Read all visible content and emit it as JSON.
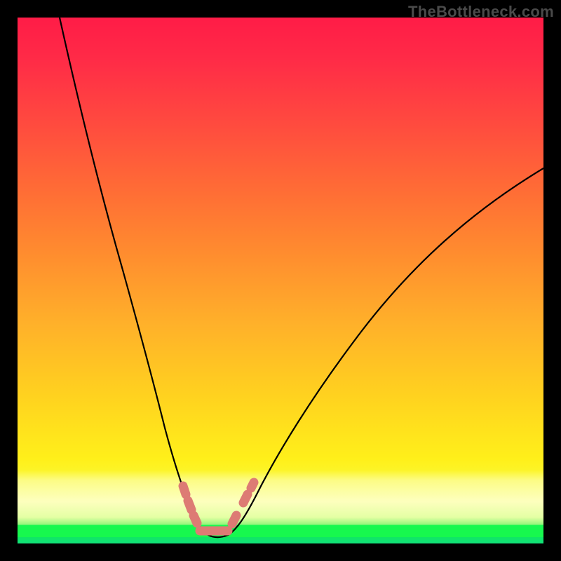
{
  "watermark": "TheBottleneck.com",
  "chart_data": {
    "type": "line",
    "title": "",
    "xlabel": "",
    "ylabel": "",
    "xlim": [
      0,
      100
    ],
    "ylim": [
      0,
      100
    ],
    "grid": false,
    "legend": false,
    "background": "heatmap-gradient-vertical",
    "gradient_stops": [
      {
        "pos": 0.0,
        "color": "#ff1c47"
      },
      {
        "pos": 0.2,
        "color": "#ff4a3f"
      },
      {
        "pos": 0.44,
        "color": "#ff8a2f"
      },
      {
        "pos": 0.72,
        "color": "#ffd21f"
      },
      {
        "pos": 0.88,
        "color": "#fff6a0"
      },
      {
        "pos": 0.965,
        "color": "#17f84e"
      },
      {
        "pos": 1.0,
        "color": "#12e27a"
      }
    ],
    "series": [
      {
        "name": "bottleneck-curve",
        "color": "#000000",
        "x": [
          8,
          12,
          16,
          20,
          24,
          27,
          29,
          31,
          33,
          34.5,
          36,
          38,
          40,
          42,
          44,
          48,
          55,
          65,
          78,
          90,
          100
        ],
        "y": [
          100,
          82,
          66,
          52,
          38,
          27,
          20,
          13,
          7,
          3,
          1.4,
          1.2,
          1.4,
          3,
          7,
          15,
          27,
          40,
          52,
          61,
          68
        ]
      }
    ],
    "markers": {
      "name": "trough-markers",
      "color": "#dd7b74",
      "points": [
        {
          "x": 31.5,
          "y": 10.5
        },
        {
          "x": 32.7,
          "y": 7.5
        },
        {
          "x": 33.7,
          "y": 5.0
        },
        {
          "x": 35.0,
          "y": 2.6
        },
        {
          "x": 36.5,
          "y": 1.6
        },
        {
          "x": 38.0,
          "y": 1.5
        },
        {
          "x": 39.5,
          "y": 1.6
        },
        {
          "x": 41.0,
          "y": 2.6
        },
        {
          "x": 43.5,
          "y": 6.5
        },
        {
          "x": 44.8,
          "y": 9.5
        }
      ]
    },
    "notes": "Values estimated from pixel positions; axes are unlabeled in source image."
  }
}
